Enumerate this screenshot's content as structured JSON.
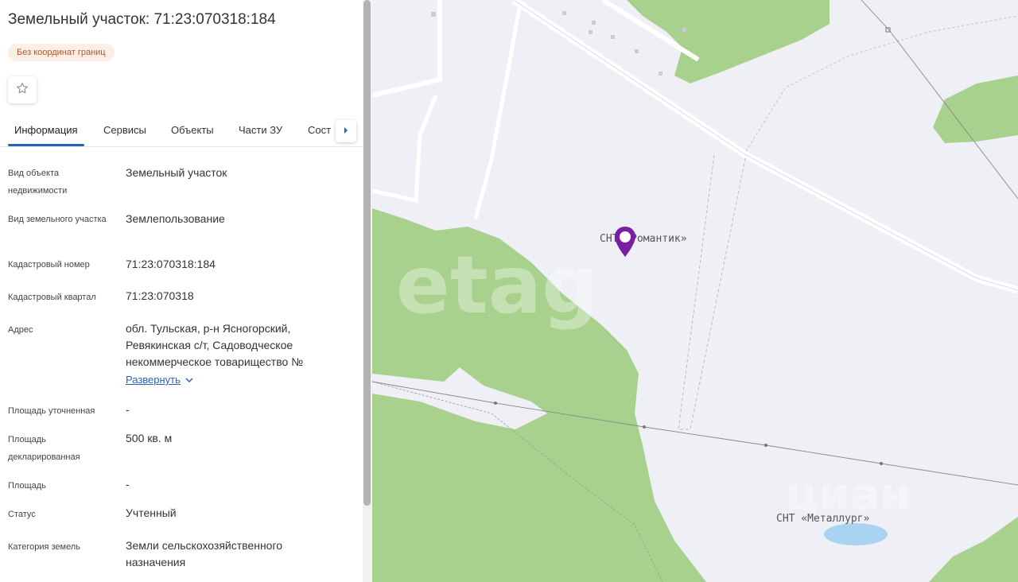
{
  "header": {
    "title": "Земельный участок: 71:23:070318:184",
    "badge": "Без координат границ",
    "favorite_icon": "star-icon"
  },
  "tabs": [
    {
      "label": "Информация",
      "active": true
    },
    {
      "label": "Сервисы"
    },
    {
      "label": "Объекты"
    },
    {
      "label": "Части ЗУ"
    },
    {
      "label": "Соста"
    }
  ],
  "info": {
    "kind_label": "Вид объекта недвижимости",
    "kind_value": "Земельный участок",
    "land_kind_label": "Вид земельного участка",
    "land_kind_value": "Землепользование",
    "cad_number_label": "Кадастровый номер",
    "cad_number_value": "71:23:070318:184",
    "cad_block_label": "Кадастровый квартал",
    "cad_block_value": "71:23:070318",
    "address_label": "Адрес",
    "address_value": "обл. Тульская, р-н Ясногорский, Ревякинская с/т, Садоводческое некоммерческое товарищество №",
    "expand_label": "Развернуть",
    "area_refined_label": "Площадь уточненная",
    "area_refined_value": "-",
    "area_declared_label": "Площадь декларированная",
    "area_declared_value": "500 кв. м",
    "area_label": "Площадь",
    "area_value": "-",
    "status_label": "Статус",
    "status_value": "Учтенный",
    "category_label": "Категория земель",
    "category_value": "Земли сельскохозяйственного назначения"
  },
  "map": {
    "label_romantik": "СНТ «Романтик»",
    "label_metallurg": "СНТ «Металлург»",
    "watermark_etag": "etag",
    "watermark_cian": "циан",
    "pin_icon": "map-pin-icon",
    "colors": {
      "background": "#eef0f5",
      "forest": "#a8d18d",
      "water": "#aad3f2",
      "pin": "#7a1fa2",
      "accent": "#2c62b6"
    }
  }
}
